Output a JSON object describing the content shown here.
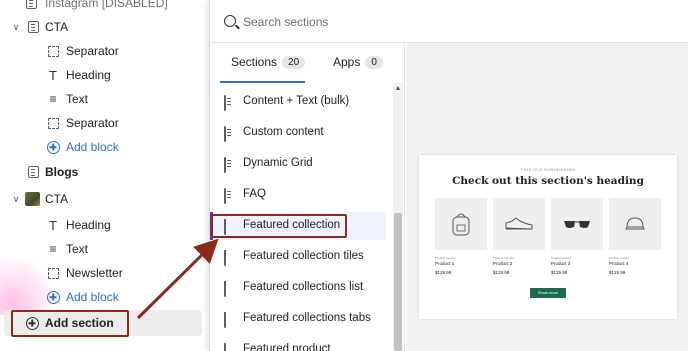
{
  "sidebar": {
    "items": [
      {
        "label": "Instagram [DISABLED]",
        "icon": "section-icon"
      },
      {
        "label": "CTA",
        "icon": "section-icon"
      },
      {
        "label": "Separator",
        "icon": "dashed-box-icon"
      },
      {
        "label": "Heading",
        "icon": "text-t-icon"
      },
      {
        "label": "Text",
        "icon": "text-lines-icon"
      },
      {
        "label": "Separator",
        "icon": "dashed-box-icon"
      },
      {
        "label": "Add block",
        "icon": "plus-circle-icon"
      },
      {
        "label": "Blogs",
        "icon": "blog-icon"
      },
      {
        "label": "CTA",
        "icon": "image-thumbnail-icon"
      },
      {
        "label": "Heading",
        "icon": "text-t-icon"
      },
      {
        "label": "Text",
        "icon": "text-lines-icon"
      },
      {
        "label": "Newsletter",
        "icon": "dashed-box-icon"
      },
      {
        "label": "Add block",
        "icon": "plus-circle-icon"
      }
    ],
    "add_section_label": "Add section"
  },
  "popup": {
    "search_placeholder": "Search sections",
    "tabs": [
      {
        "label": "Sections",
        "count": "20",
        "active": true
      },
      {
        "label": "Apps",
        "count": "0",
        "active": false
      }
    ],
    "items": [
      {
        "label": "Content + Text (bulk)",
        "icon": "document-icon"
      },
      {
        "label": "Custom content",
        "icon": "document-icon"
      },
      {
        "label": "Dynamic Grid",
        "icon": "document-icon"
      },
      {
        "label": "FAQ",
        "icon": "document-icon"
      },
      {
        "label": "Featured collection",
        "icon": "tag-icon",
        "selected": true
      },
      {
        "label": "Featured collection tiles",
        "icon": "tag-icon"
      },
      {
        "label": "Featured collections list",
        "icon": "tag-icon"
      },
      {
        "label": "Featured collections tabs",
        "icon": "tag-icon"
      },
      {
        "label": "Featured product",
        "icon": "tag-icon"
      }
    ]
  },
  "preview": {
    "eyebrow": "THIS IS A SUBHEADING",
    "heading": "Check out this section's heading",
    "products": [
      {
        "vendor": "Product Vendor",
        "name": "Product 1",
        "price": "$129.99",
        "icon": "backpack-icon"
      },
      {
        "vendor": "Product Vendor",
        "name": "Product 2",
        "price": "$129.99",
        "icon": "sneaker-icon"
      },
      {
        "vendor": "Product Vendor",
        "name": "Product 3",
        "price": "$129.99",
        "icon": "sunglasses-icon"
      },
      {
        "vendor": "Product Vendor",
        "name": "Product 4",
        "price": "$129.99",
        "icon": "cap-icon"
      }
    ],
    "button_label": "Show more"
  },
  "colors": {
    "accent_blue": "#2c6ecb",
    "annotation_red": "#8b2a1a",
    "selected_bar": "#6f2dbd",
    "show_more_green": "#1e6b55"
  }
}
